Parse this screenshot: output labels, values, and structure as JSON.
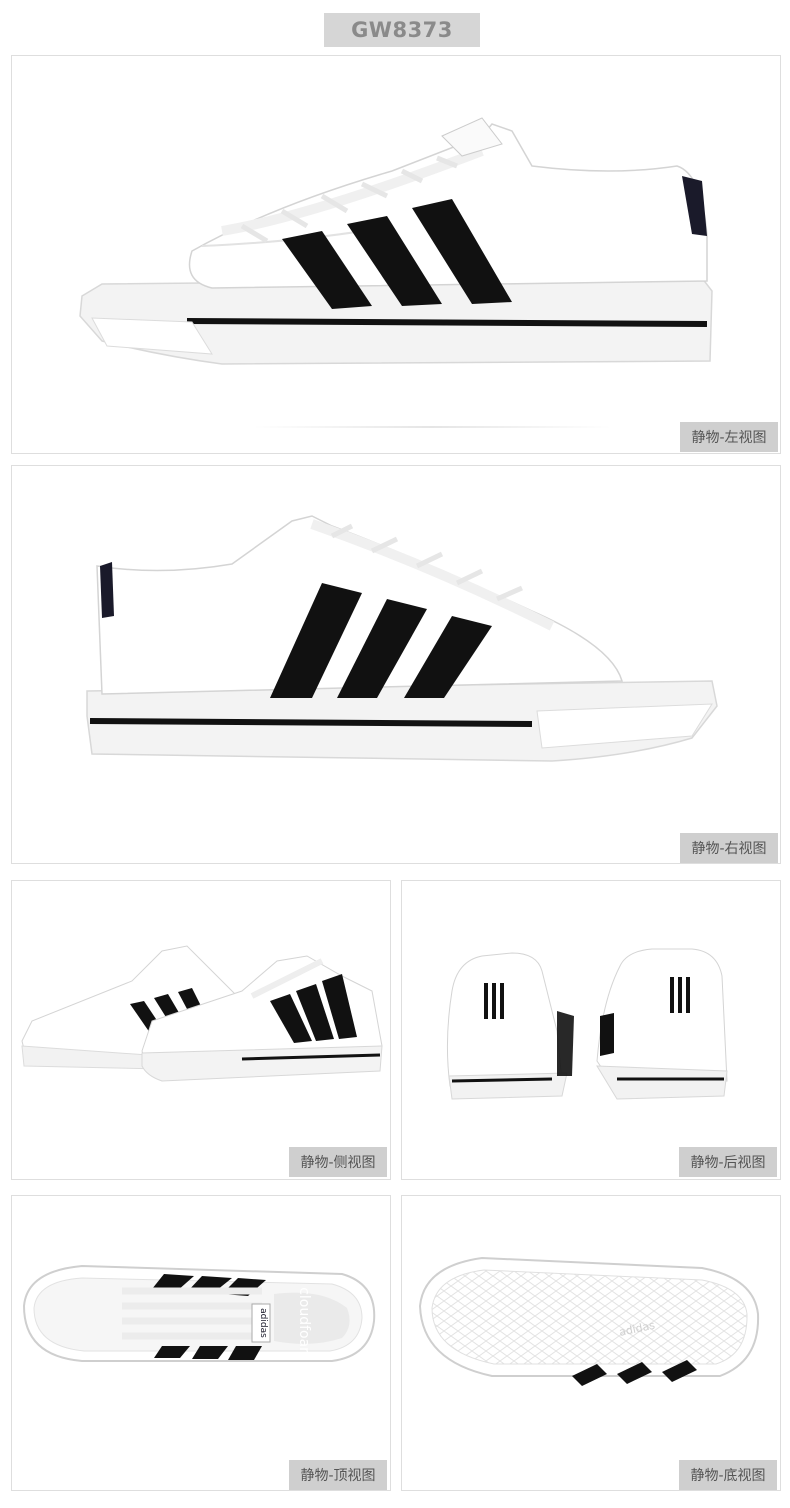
{
  "product": {
    "sku": "GW8373"
  },
  "views": [
    {
      "label": "静物-左视图"
    },
    {
      "label": "静物-右视图"
    },
    {
      "label": "静物-侧视图"
    },
    {
      "label": "静物-后视图"
    },
    {
      "label": "静物-顶视图"
    },
    {
      "label": "静物-底视图"
    }
  ],
  "brand_text": {
    "insole": "cloudfoam",
    "tongue": "adidas"
  },
  "colors": {
    "stripe": "#111111",
    "upper": "#ffffff",
    "sole": "#f2f2f2",
    "label_bg": "#cfcfcf",
    "sku_bg": "#d6d6d6"
  }
}
